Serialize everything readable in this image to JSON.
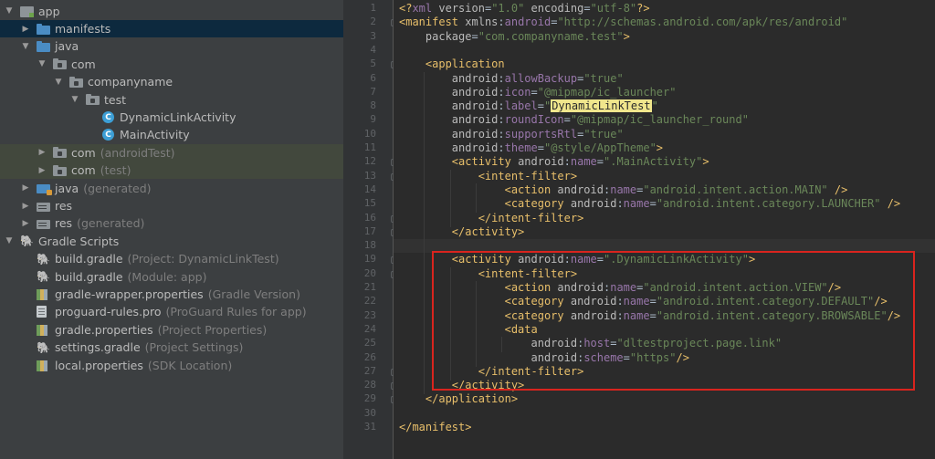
{
  "tree": [
    {
      "arrow": "down",
      "icon": "app",
      "name": "app",
      "indent": 0
    },
    {
      "arrow": "right",
      "icon": "folder-blue",
      "name": "manifests",
      "indent": 1,
      "selected": true
    },
    {
      "arrow": "down",
      "icon": "folder-blue",
      "name": "java",
      "indent": 1
    },
    {
      "arrow": "down",
      "icon": "folder-gray",
      "name": "com",
      "indent": 2
    },
    {
      "arrow": "down",
      "icon": "folder-gray",
      "name": "companyname",
      "indent": 3
    },
    {
      "arrow": "down",
      "icon": "folder-gray",
      "name": "test",
      "indent": 4
    },
    {
      "arrow": "none",
      "icon": "class",
      "name": "DynamicLinkActivity",
      "indent": 5
    },
    {
      "arrow": "none",
      "icon": "class",
      "name": "MainActivity",
      "indent": 5
    },
    {
      "arrow": "right",
      "icon": "folder-gray",
      "name": "com",
      "sub": "(androidTest)",
      "indent": 2,
      "highlight": true
    },
    {
      "arrow": "right",
      "icon": "folder-gray",
      "name": "com",
      "sub": "(test)",
      "indent": 2,
      "highlight": true
    },
    {
      "arrow": "right",
      "icon": "java-gen",
      "name": "java",
      "sub": "(generated)",
      "indent": 1
    },
    {
      "arrow": "right",
      "icon": "res",
      "name": "res",
      "indent": 1
    },
    {
      "arrow": "right",
      "icon": "res",
      "name": "res",
      "sub": "(generated)",
      "indent": 1
    },
    {
      "arrow": "down",
      "icon": "gradle",
      "name": "Gradle Scripts",
      "indent": 0
    },
    {
      "arrow": "none",
      "icon": "gradle",
      "name": "build.gradle",
      "sub": "(Project: DynamicLinkTest)",
      "indent": 1
    },
    {
      "arrow": "none",
      "icon": "gradle",
      "name": "build.gradle",
      "sub": "(Module: app)",
      "indent": 1
    },
    {
      "arrow": "none",
      "icon": "properties",
      "name": "gradle-wrapper.properties",
      "sub": "(Gradle Version)",
      "indent": 1
    },
    {
      "arrow": "none",
      "icon": "proguard",
      "name": "proguard-rules.pro",
      "sub": "(ProGuard Rules for app)",
      "indent": 1
    },
    {
      "arrow": "none",
      "icon": "properties",
      "name": "gradle.properties",
      "sub": "(Project Properties)",
      "indent": 1
    },
    {
      "arrow": "none",
      "icon": "gradle",
      "name": "settings.gradle",
      "sub": "(Project Settings)",
      "indent": 1
    },
    {
      "arrow": "none",
      "icon": "properties",
      "name": "local.properties",
      "sub": "(SDK Location)",
      "indent": 1
    }
  ],
  "code_lines": [
    "<?xml version=\"1.0\" encoding=\"utf-8\"?>",
    "<manifest xmlns:android=\"http://schemas.android.com/apk/res/android\"",
    "    package=\"com.companyname.test\">",
    "",
    "    <application",
    "        android:allowBackup=\"true\"",
    "        android:icon=\"@mipmap/ic_launcher\"",
    "        android:label=\"DynamicLinkTest\"",
    "        android:roundIcon=\"@mipmap/ic_launcher_round\"",
    "        android:supportsRtl=\"true\"",
    "        android:theme=\"@style/AppTheme\">",
    "        <activity android:name=\".MainActivity\">",
    "            <intent-filter>",
    "                <action android:name=\"android.intent.action.MAIN\" />",
    "                <category android:name=\"android.intent.category.LAUNCHER\" />",
    "            </intent-filter>",
    "        </activity>",
    "",
    "        <activity android:name=\".DynamicLinkActivity\">",
    "            <intent-filter>",
    "                <action android:name=\"android.intent.action.VIEW\"/>",
    "                <category android:name=\"android.intent.category.DEFAULT\"/>",
    "                <category android:name=\"android.intent.category.BROWSABLE\"/>",
    "                <data",
    "                    android:host=\"dltestproject.page.link\"",
    "                    android:scheme=\"https\"/>",
    "            </intent-filter>",
    "        </activity>",
    "    </application>",
    "",
    "</manifest>"
  ],
  "highlighted_value": "DynamicLinkTest",
  "current_line": 18,
  "colors": {
    "tree_bg": "#3c3f41",
    "editor_bg": "#2b2b2b",
    "tag": "#e8bf6a",
    "attr_name": "#bababa",
    "namespace": "#9876aa",
    "string": "#6a8759",
    "selection_box": "#d9241e"
  },
  "icons": {
    "collapse": "chevron-down-icon",
    "expand": "chevron-right-icon",
    "class": "class-c-icon",
    "intention": "lightbulb-icon"
  }
}
